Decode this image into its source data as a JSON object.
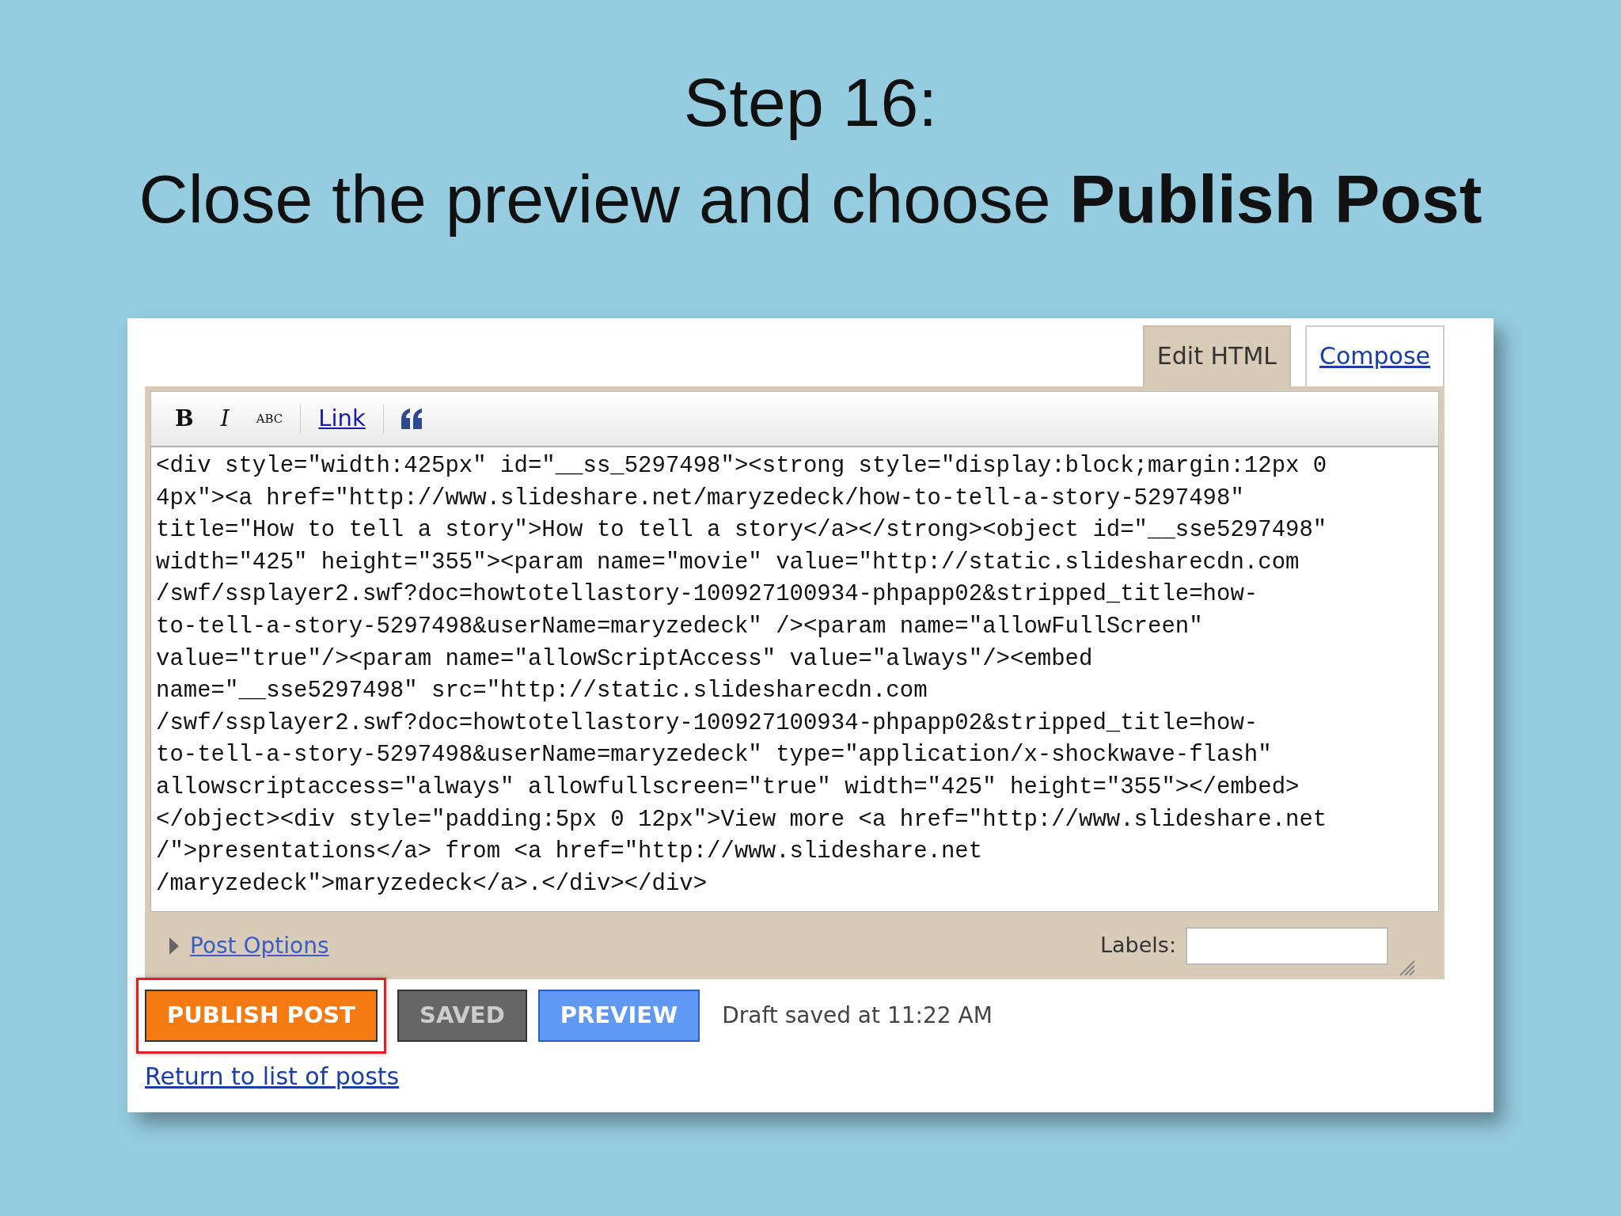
{
  "slide": {
    "title_lines": [
      "Step 16:",
      "Close the preview and choose **Publish Post**"
    ]
  },
  "editor": {
    "tabs": [
      {
        "label": "Edit HTML",
        "selected": true
      },
      {
        "label": "Compose",
        "selected": false
      }
    ],
    "toolbar": [
      {
        "kind": "bold",
        "label": "B"
      },
      {
        "kind": "italic",
        "label": "I"
      },
      {
        "kind": "spellcheck",
        "label": "ABC"
      },
      {
        "kind": "link",
        "label": "Link"
      },
      {
        "kind": "quote"
      }
    ],
    "code_lines": [
      "<div style=\"width:425px\" id=\"__ss_5297498\"><strong style=\"display:block;margin:12px 0",
      "4px\"><a href=\"http://www.slideshare.net/maryzedeck/how-to-tell-a-story-5297498\"",
      "title=\"How to tell a story\">How to tell a story</a></strong><object id=\"__sse5297498\"",
      "width=\"425\" height=\"355\"><param name=\"movie\" value=\"http://static.slidesharecdn.com",
      "/swf/ssplayer2.swf?doc=howtotellastory-100927100934-phpapp02&stripped_title=how-",
      "to-tell-a-story-5297498&userName=maryzedeck\" /><param name=\"allowFullScreen\"",
      "value=\"true\"/><param name=\"allowScriptAccess\" value=\"always\"/><embed",
      "name=\"__sse5297498\" src=\"http://static.slidesharecdn.com",
      "/swf/ssplayer2.swf?doc=howtotellastory-100927100934-phpapp02&stripped_title=how-",
      "to-tell-a-story-5297498&userName=maryzedeck\" type=\"application/x-shockwave-flash\"",
      "allowscriptaccess=\"always\" allowfullscreen=\"true\" width=\"425\" height=\"355\"></embed>",
      "</object><div style=\"padding:5px 0 12px\">View more <a href=\"http://www.slideshare.net",
      "/\">presentations</a> from <a href=\"http://www.slideshare.net",
      "/maryzedeck\">maryzedeck</a>.</div></div>"
    ],
    "post_options": {
      "label": "Post Options",
      "expanded": false
    },
    "labels": {
      "label": "Labels:"
    }
  },
  "buttons": [
    {
      "kind": "publish",
      "label": "PUBLISH POST",
      "highlighted": true
    },
    {
      "kind": "saved",
      "label": "SAVED",
      "highlighted": false
    },
    {
      "kind": "preview",
      "label": "PREVIEW",
      "highlighted": false
    }
  ],
  "status": "Draft saved at 11:22 AM",
  "return_link": "Return to list of posts"
}
